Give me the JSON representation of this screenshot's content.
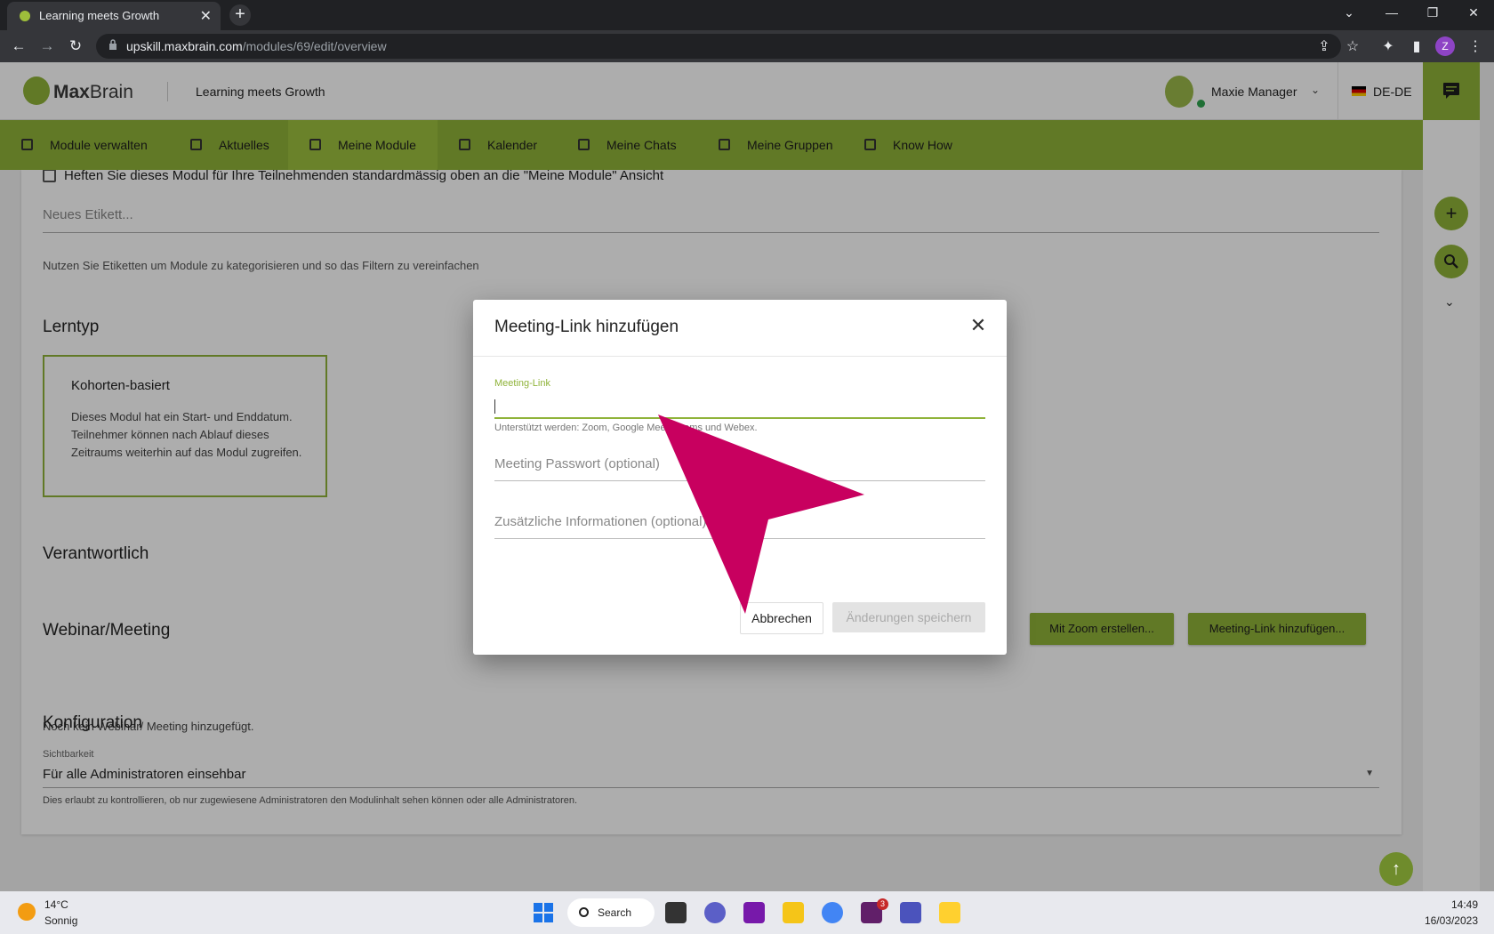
{
  "browser": {
    "tab_title": "Learning meets Growth",
    "url_host": "upskill.maxbrain.com",
    "url_path": "/modules/69/edit/overview",
    "profile_initial": "Z"
  },
  "header": {
    "logo_bold": "Max",
    "logo_rest": "Brain",
    "tagline": "Learning meets Growth",
    "user_name": "Maxie Manager",
    "language": "DE-DE"
  },
  "nav": {
    "items": [
      {
        "label": "Module verwalten",
        "icon": "folder-account-icon"
      },
      {
        "label": "Aktuelles",
        "icon": "news-icon"
      },
      {
        "label": "Meine Module",
        "icon": "graduation-cap-icon"
      },
      {
        "label": "Kalender",
        "icon": "calendar-icon"
      },
      {
        "label": "Meine Chats",
        "icon": "chat-icon"
      },
      {
        "label": "Meine Gruppen",
        "icon": "group-icon"
      },
      {
        "label": "Know How",
        "icon": "book-icon"
      }
    ],
    "active": "Meine Module"
  },
  "content": {
    "pin_text": "Heften Sie dieses Modul für Ihre Teilnehmenden standardmässig oben an die \"Meine Module\" Ansicht",
    "tag_placeholder": "Neues Etikett...",
    "tag_hint": "Nutzen Sie Etiketten um Module zu kategorisieren und so das Filtern zu vereinfachen",
    "lerntyp_title": "Lerntyp",
    "card_title": "Kohorten-basiert",
    "card_desc": "Dieses Modul hat ein Start- und Enddatum. Teilnehmer können nach Ablauf dieses Zeitraums weiterhin auf das Modul zugreifen.",
    "verantwortlich_title": "Verantwortlich",
    "webinar_title": "Webinar/Meeting",
    "webinar_empty": "Noch kein Webinar/ Meeting hinzugefügt.",
    "zoom_button": "Mit Zoom erstellen...",
    "add_link_button": "Meeting-Link hinzufügen...",
    "config_title": "Konfiguration",
    "visibility_label": "Sichtbarkeit",
    "visibility_value": "Für alle Administratoren einsehbar",
    "visibility_hint": "Dies erlaubt zu kontrollieren, ob nur zugewiesene Administratoren den Modulinhalt sehen können oder alle Administratoren."
  },
  "dialog": {
    "title": "Meeting-Link hinzufügen",
    "link_label": "Meeting-Link",
    "link_value": "",
    "link_hint": "Unterstützt werden: Zoom, Google Meet, Teams und Webex.",
    "password_placeholder": "Meeting Passwort (optional)",
    "info_placeholder": "Zusätzliche Informationen (optional)",
    "cancel": "Abbrechen",
    "save": "Änderungen speichern"
  },
  "taskbar": {
    "temp": "14°C",
    "condition": "Sonnig",
    "search": "Search",
    "time": "14:49",
    "date": "16/03/2023",
    "slack_badge": "3"
  },
  "colors": {
    "brand_green": "#8fb339",
    "cursor_magenta": "#c8005f"
  }
}
